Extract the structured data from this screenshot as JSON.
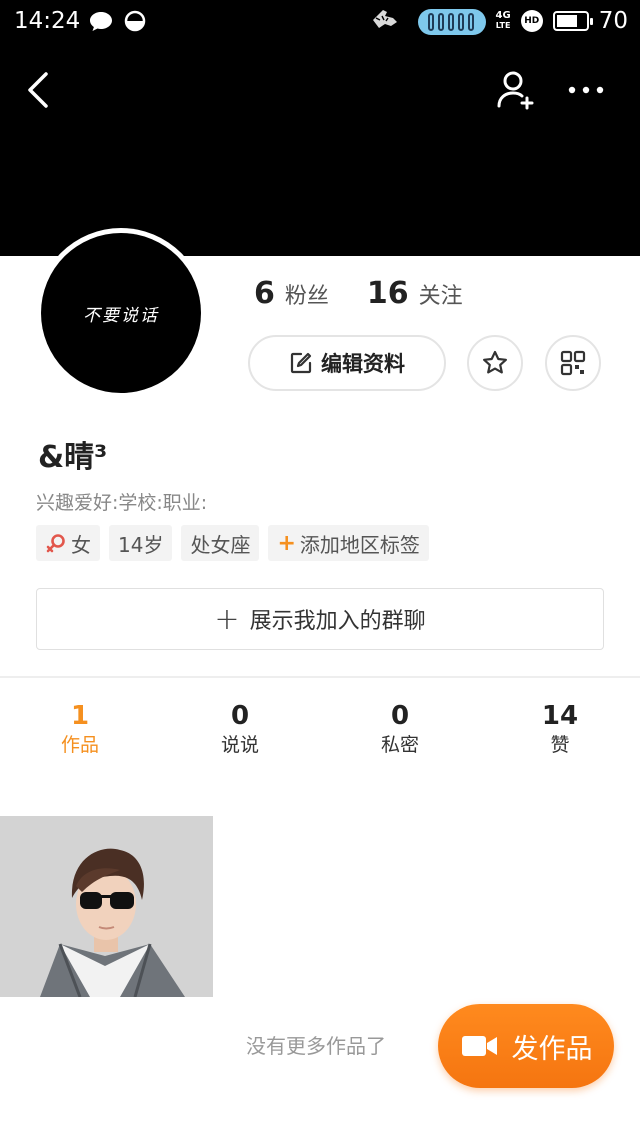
{
  "status_bar": {
    "time": "14:24",
    "network": "4G",
    "network_sub": "LTE",
    "hd": "HD",
    "battery_percent": "70",
    "battery_level": 0.7,
    "icons": [
      "chat-bubble-icon",
      "half-moon-icon",
      "ghost-icon",
      "signal-pill-icon"
    ]
  },
  "header": {
    "background": "#000000",
    "icons": [
      "back-arrow-icon",
      "add-user-icon",
      "more-icon"
    ]
  },
  "profile": {
    "avatar_text": "不要说话",
    "followers_count": "6",
    "followers_label": "粉丝",
    "following_count": "16",
    "following_label": "关注",
    "edit_button": "编辑资料",
    "nickname": "&晴³",
    "bio": "兴趣爱好:学校:职业:",
    "tags": {
      "gender": "女",
      "age": "14岁",
      "zodiac": "处女座",
      "add_region": "添加地区标签"
    },
    "group_button": "展示我加入的群聊"
  },
  "tabs": [
    {
      "count": "1",
      "label": "作品",
      "active": true
    },
    {
      "count": "0",
      "label": "说说",
      "active": false
    },
    {
      "count": "0",
      "label": "私密",
      "active": false
    },
    {
      "count": "14",
      "label": "赞",
      "active": false
    }
  ],
  "works": {
    "items": [
      {
        "type": "photo"
      }
    ],
    "no_more_text": "没有更多作品了",
    "publish_button": "发作品"
  },
  "colors": {
    "accent": "#f5901f",
    "publish_gradient_top": "#ff8a1e",
    "publish_gradient_bottom": "#f57510",
    "gender_icon": "#e2574c"
  }
}
